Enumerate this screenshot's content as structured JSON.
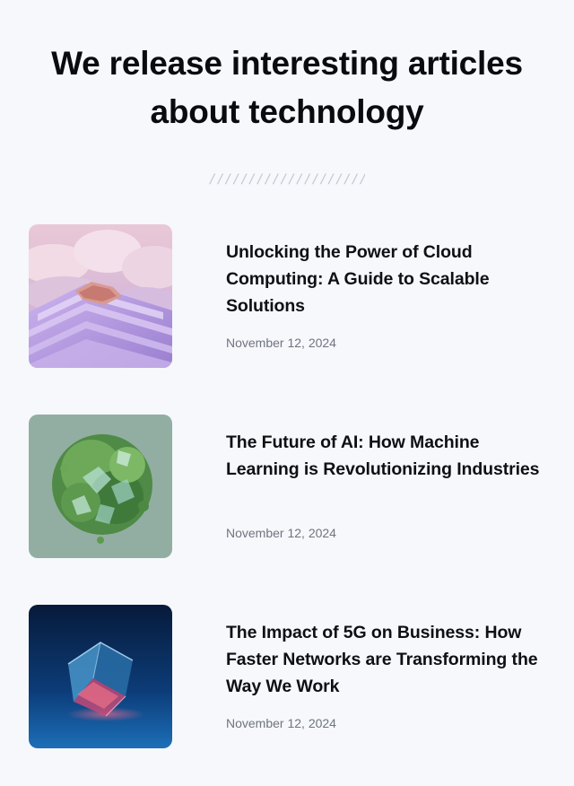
{
  "header": {
    "title_line1": "We release interesting articles",
    "title_line2": "about technology",
    "divider": "////////////////////"
  },
  "articles": [
    {
      "title": "Unlocking the Power of Cloud Computing: A Guide to Scalable Solutions",
      "date": "November 12, 2024",
      "image": "cloud-steps-image"
    },
    {
      "title": "The Future of AI: How Machine Learning is Revolutionizing Industries",
      "date": "November 12, 2024",
      "image": "green-crystal-sphere-image"
    },
    {
      "title": "The Impact of 5G on Business: How Faster Networks are Transforming the Way We Work",
      "date": "November 12, 2024",
      "image": "glowing-glass-cube-image"
    }
  ],
  "colors": {
    "background": "#f6f8fb",
    "heading": "#0b0b0f",
    "date": "#6f7480",
    "divider": "#c3c7cf"
  }
}
